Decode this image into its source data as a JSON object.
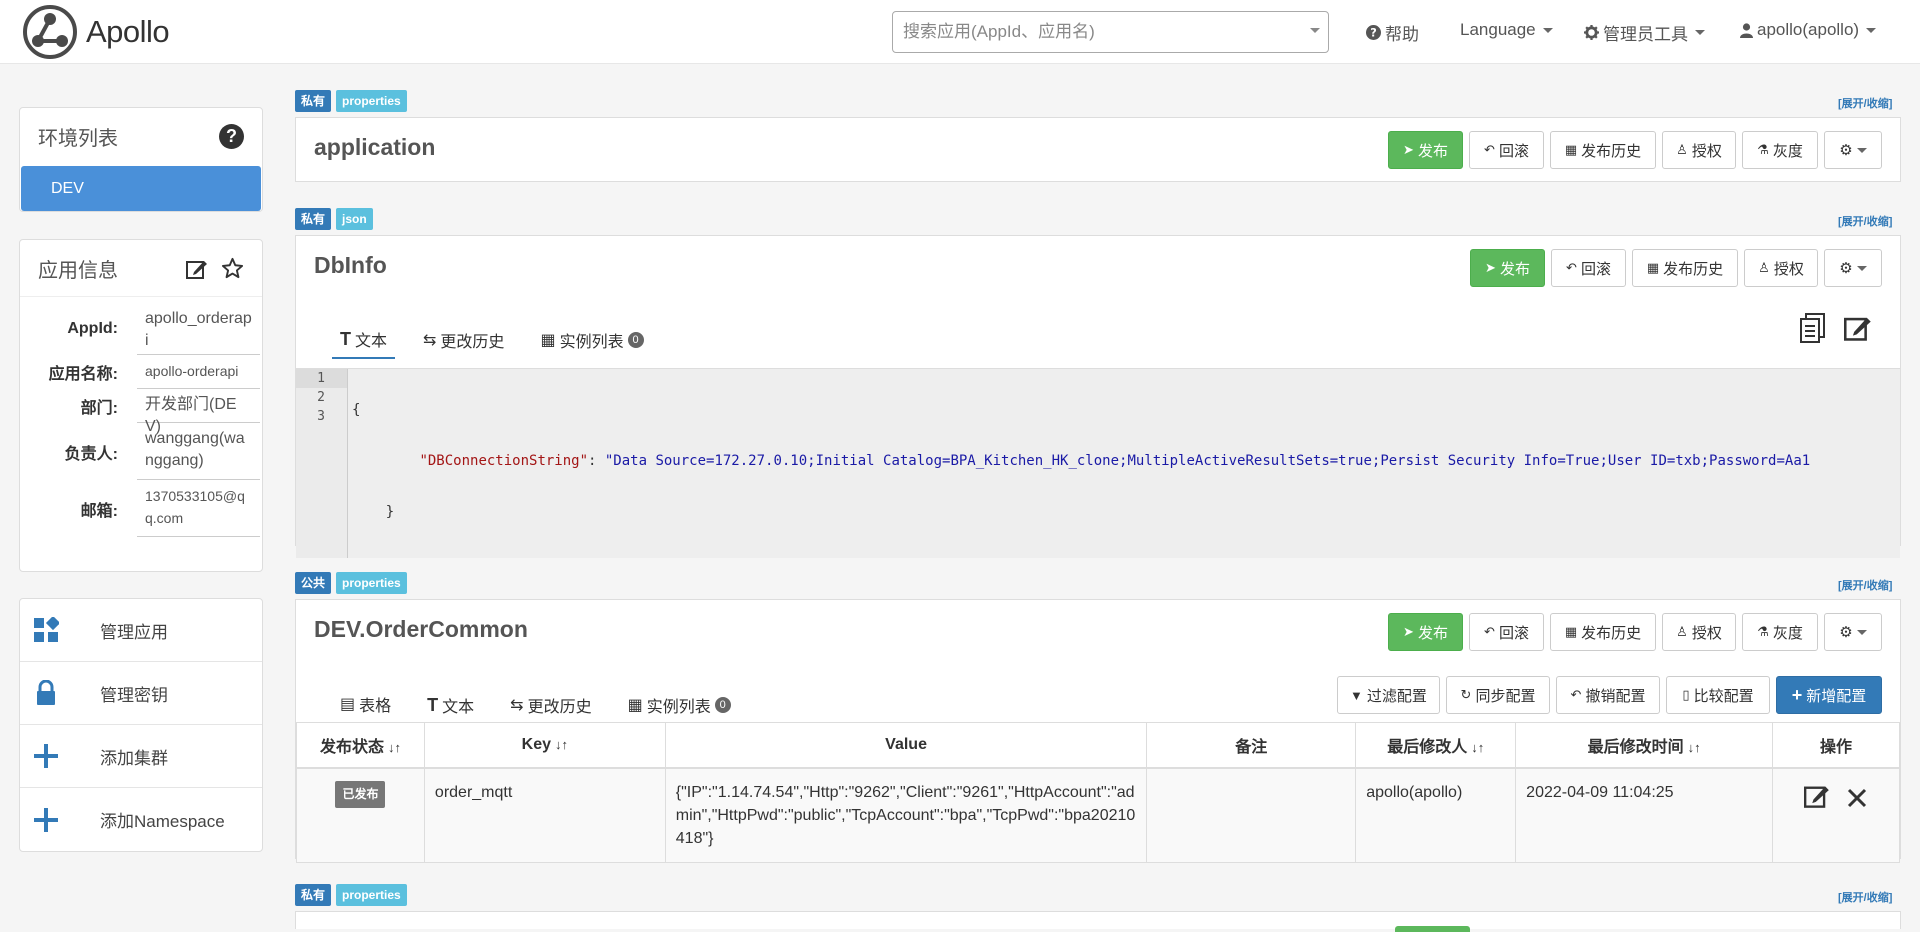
{
  "header": {
    "logo_text": "Apollo",
    "search_placeholder": "搜索应用(AppId、应用名)",
    "help": "帮助",
    "language": "Language",
    "admin_tools": "管理员工具",
    "user": "apollo(apollo)"
  },
  "sidebar": {
    "env_title": "环境列表",
    "env_help": "?",
    "env_items": [
      "DEV"
    ],
    "app_info_title": "应用信息",
    "app_info": [
      {
        "label": "AppId:",
        "value": "apollo_orderapi"
      },
      {
        "label": "应用名称:",
        "value": "apollo-orderapi"
      },
      {
        "label": "部门:",
        "value": "开发部门(DEV)"
      },
      {
        "label": "负责人:",
        "value": "wanggang(wanggang)"
      },
      {
        "label": "邮箱:",
        "value": "1370533105@qq.com"
      }
    ],
    "menu": [
      "管理应用",
      "管理密钥",
      "添加集群",
      "添加Namespace"
    ]
  },
  "namespaces": [
    {
      "scope": "私有",
      "format": "properties",
      "expand": "[展开/收缩]",
      "name": "application",
      "buttons": [
        "发布",
        "回滚",
        "发布历史",
        "授权",
        "灰度"
      ]
    },
    {
      "scope": "私有",
      "format": "json",
      "expand": "[展开/收缩]",
      "name": "DbInfo",
      "buttons": [
        "发布",
        "回滚",
        "发布历史",
        "授权"
      ],
      "tabs": [
        "文本",
        "更改历史",
        "实例列表"
      ],
      "instance_count": "0",
      "code": {
        "line_numbers": [
          "1",
          "2",
          "3"
        ],
        "line1": "{",
        "key": "\"DBConnectionString\"",
        "sep": ": ",
        "value": "\"Data Source=172.27.0.10;Initial Catalog=BPA_Kitchen_HK_clone;MultipleActiveResultSets=true;Persist Security Info=True;User ID=txb;Password=Aa1",
        "line3": "}"
      }
    },
    {
      "scope": "公共",
      "format": "properties",
      "expand": "[展开/收缩]",
      "name": "DEV.OrderCommon",
      "buttons": [
        "发布",
        "回滚",
        "发布历史",
        "授权",
        "灰度"
      ],
      "tabs": [
        "表格",
        "文本",
        "更改历史",
        "实例列表"
      ],
      "instance_count": "0",
      "toolbar": [
        "过滤配置",
        "同步配置",
        "撤销配置",
        "比较配置",
        "新增配置"
      ],
      "table": {
        "headers": [
          "发布状态",
          "Key",
          "Value",
          "备注",
          "最后修改人",
          "最后修改时间",
          "操作"
        ],
        "rows": [
          {
            "status": "已发布",
            "key": "order_mqtt",
            "value": "{\"IP\":\"1.14.74.54\",\"Http\":\"9262\",\"Client\":\"9261\",\"HttpAccount\":\"admin\",\"HttpPwd\":\"public\",\"TcpAccount\":\"bpa\",\"TcpPwd\":\"bpa20210418\"}",
            "comment": "",
            "modifier": "apollo(apollo)",
            "time": "2022-04-09 11:04:25"
          }
        ]
      }
    },
    {
      "scope": "私有",
      "format": "properties",
      "expand": "[展开/收缩]"
    }
  ],
  "colors": {
    "primary": "#337ab7",
    "info": "#5bc0de",
    "success": "#5cb85c",
    "env_active": "#4a90d9"
  }
}
